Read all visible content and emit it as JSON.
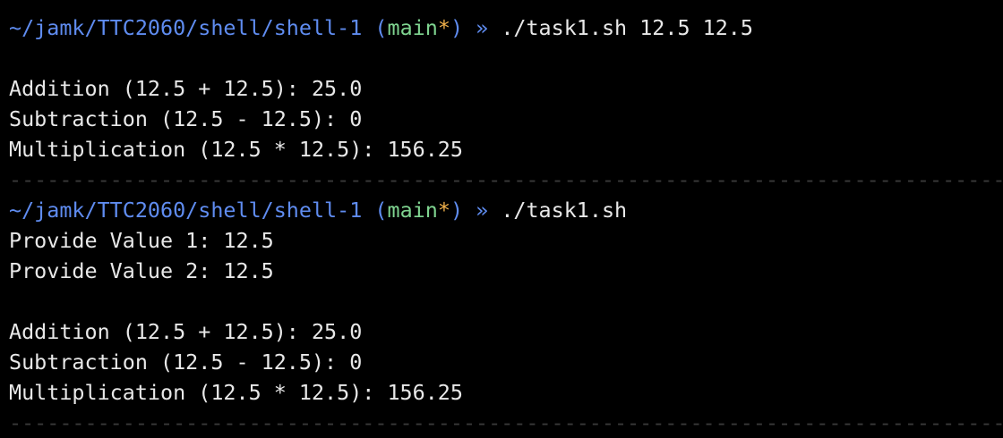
{
  "colors": {
    "background": "#000000",
    "text": "#e8e8e8",
    "path": "#5f8cf0",
    "branch": "#7fd490",
    "dirty_marker": "#f0b04a",
    "separator": "#3a3a3a"
  },
  "prompt": {
    "path": "~/jamk/TTC2060/shell/shell-1",
    "open_paren": "(",
    "branch": "main",
    "dirty": "*",
    "close_paren": ")",
    "arrow": "»"
  },
  "session1": {
    "command": "./task1.sh 12.5 12.5",
    "output": [
      "Addition (12.5 + 12.5): 25.0",
      "Subtraction (12.5 - 12.5): 0",
      "Multiplication (12.5 * 12.5): 156.25"
    ]
  },
  "session2": {
    "command": "./task1.sh",
    "prompts": [
      "Provide Value 1: 12.5",
      "Provide Value 2: 12.5"
    ],
    "output": [
      "Addition (12.5 + 12.5): 25.0",
      "Subtraction (12.5 - 12.5): 0",
      "Multiplication (12.5 * 12.5): 156.25"
    ]
  },
  "separator": "----------------------------------------------------------------------------------------------------------------------------"
}
